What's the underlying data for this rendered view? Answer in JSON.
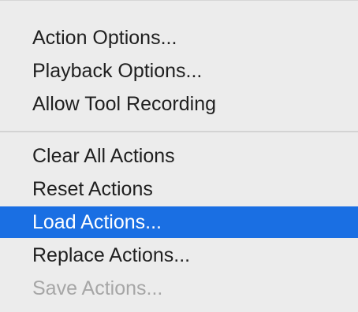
{
  "menu": {
    "items": [
      {
        "label": "Action Options...",
        "state": "normal"
      },
      {
        "label": "Playback Options...",
        "state": "normal"
      },
      {
        "label": "Allow Tool Recording",
        "state": "normal"
      },
      {
        "label": "Clear All Actions",
        "state": "normal"
      },
      {
        "label": "Reset Actions",
        "state": "normal"
      },
      {
        "label": "Load Actions...",
        "state": "highlighted"
      },
      {
        "label": "Replace Actions...",
        "state": "normal"
      },
      {
        "label": "Save Actions...",
        "state": "disabled"
      }
    ],
    "colors": {
      "highlight": "#1a6fe3",
      "text": "#1f1f1f",
      "disabled_text": "#a6a6a6"
    }
  }
}
